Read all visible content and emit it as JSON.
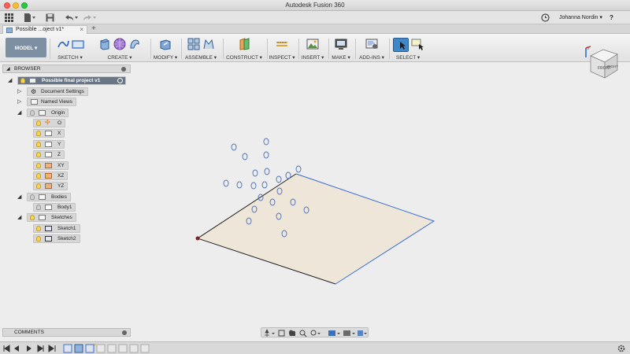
{
  "window": {
    "title": "Autodesk Fusion 360"
  },
  "quick_access": {
    "user_name": "Johanna Nordin ▾",
    "help_label": "?"
  },
  "tab": {
    "title": "Possible ...oject v1*",
    "new_tab": "+"
  },
  "toolbar": {
    "workspace": "MODEL ▾",
    "groups": [
      {
        "label": "SKETCH ▾"
      },
      {
        "label": "CREATE ▾"
      },
      {
        "label": "MODIFY ▾"
      },
      {
        "label": "ASSEMBLE ▾"
      },
      {
        "label": "CONSTRUCT ▾"
      },
      {
        "label": "INSPECT ▾"
      },
      {
        "label": "INSERT ▾"
      },
      {
        "label": "MAKE ▾"
      },
      {
        "label": "ADD-INS ▾"
      },
      {
        "label": "SELECT ▾"
      }
    ]
  },
  "viewcube": {
    "front": "FRONT",
    "right": "RIGHT"
  },
  "browser": {
    "title": "BROWSER",
    "root": "Possible final project v1",
    "items": [
      {
        "label": "Document Settings"
      },
      {
        "label": "Named Views"
      },
      {
        "label": "Origin"
      },
      {
        "label": "O"
      },
      {
        "label": "X"
      },
      {
        "label": "Y"
      },
      {
        "label": "Z"
      },
      {
        "label": "XY"
      },
      {
        "label": "XZ"
      },
      {
        "label": "YZ"
      },
      {
        "label": "Bodies"
      },
      {
        "label": "Body1"
      },
      {
        "label": "Sketches"
      },
      {
        "label": "Sketch1"
      },
      {
        "label": "Sketch2"
      }
    ]
  },
  "comments": {
    "title": "COMMENTS"
  },
  "colors": {
    "accent": "#3b6fd6",
    "plane_fill": "#efe6da",
    "workspace": "#7d8fa3"
  }
}
